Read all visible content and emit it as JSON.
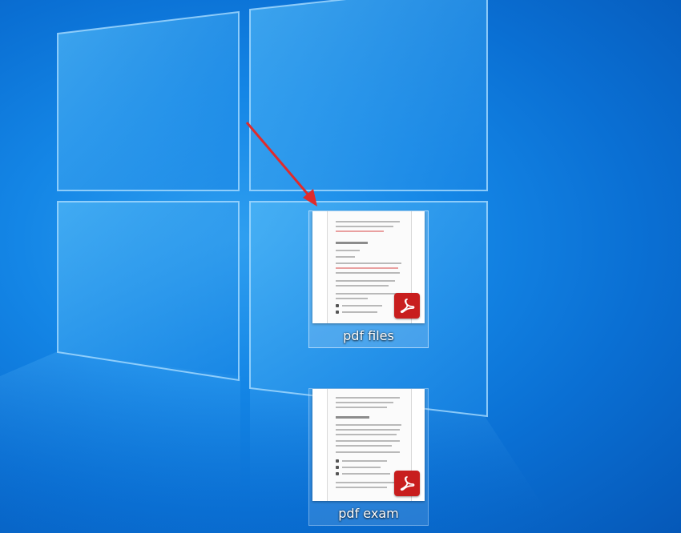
{
  "desktop": {
    "colors": {
      "background": "#0a6fd3",
      "accent_arrow": "#e02b2b",
      "pdf_badge": "#c81e1e"
    },
    "icons": [
      {
        "label": "pdf files",
        "type": "pdf-document",
        "selected": true
      },
      {
        "label": "pdf exam",
        "type": "pdf-document",
        "selected": false
      }
    ],
    "annotation": {
      "type": "red-arrow",
      "points_to": "pdf files"
    }
  }
}
